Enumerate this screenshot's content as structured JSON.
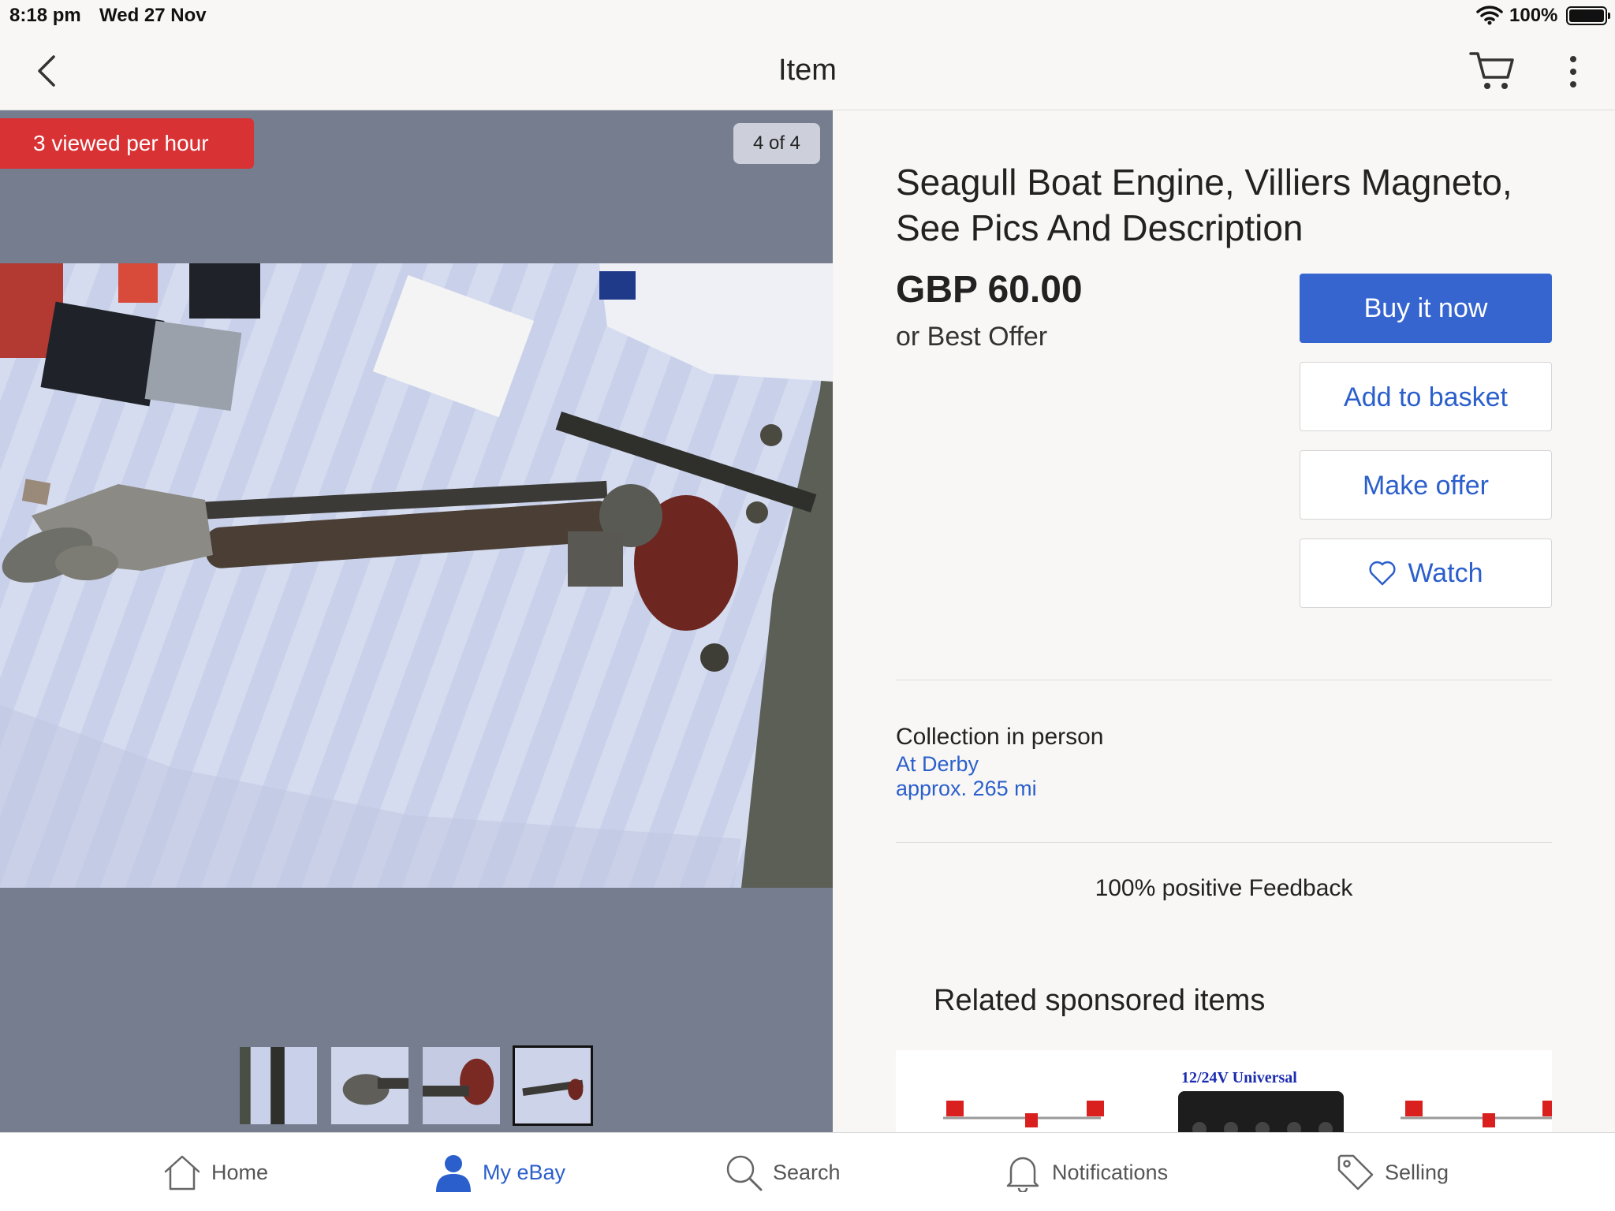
{
  "status_bar": {
    "time": "8:18 pm",
    "date": "Wed 27 Nov",
    "battery": "100%"
  },
  "nav": {
    "title": "Item",
    "back_icon": "chevron-left-icon",
    "cart_icon": "cart-icon",
    "more_icon": "more-vertical-icon"
  },
  "gallery": {
    "views_badge": "3 viewed per hour",
    "image_counter": "4 of 4",
    "thumbnail_count": 4,
    "active_thumbnail": 4
  },
  "item": {
    "title": "Seagull Boat Engine, Villiers Magneto, See Pics And Description",
    "price": "GBP 60.00",
    "offer_text": "or Best Offer"
  },
  "actions": {
    "buy_now": "Buy it now",
    "add_to_basket": "Add to basket",
    "make_offer": "Make offer",
    "watch": "Watch"
  },
  "delivery": {
    "title": "Collection in person",
    "location": "At Derby",
    "distance": "approx. 265 mi"
  },
  "seller": {
    "feedback": "100% positive Feedback"
  },
  "related": {
    "title": "Related sponsored items",
    "product_label": "12/24V Universal"
  },
  "tabs": [
    {
      "label": "Home",
      "icon": "home-icon"
    },
    {
      "label": "My eBay",
      "icon": "user-icon"
    },
    {
      "label": "Search",
      "icon": "search-icon"
    },
    {
      "label": "Notifications",
      "icon": "bell-icon"
    },
    {
      "label": "Selling",
      "icon": "tag-icon"
    }
  ],
  "colors": {
    "accent": "#3665d0",
    "link": "#2b5fcc",
    "badge_red": "#d93234",
    "gallery_bg": "#767d8f"
  }
}
